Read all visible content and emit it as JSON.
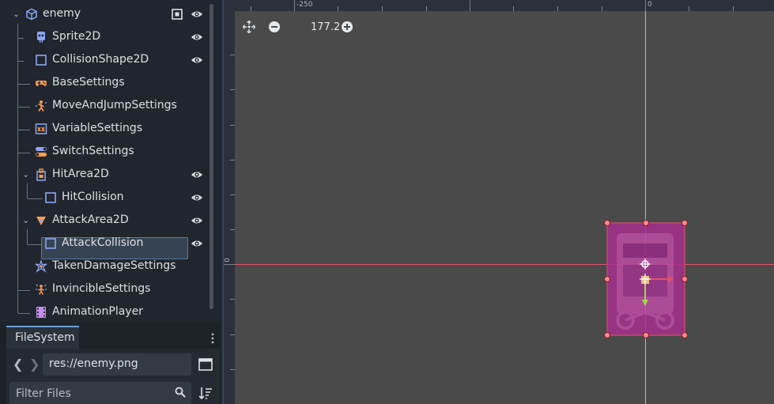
{
  "scene_tree": {
    "nodes": [
      {
        "label": "enemy",
        "icon": "node2d-icon"
      },
      {
        "label": "Sprite2D",
        "icon": "sprite2d-icon"
      },
      {
        "label": "CollisionShape2D",
        "icon": "collisionshape2d-icon"
      },
      {
        "label": "BaseSettings",
        "icon": "gamepad-icon"
      },
      {
        "label": "MoveAndJumpSettings",
        "icon": "move-jump-icon"
      },
      {
        "label": "VariableSettings",
        "icon": "variable-icon"
      },
      {
        "label": "SwitchSettings",
        "icon": "switch-icon"
      },
      {
        "label": "HitArea2D",
        "icon": "area2d-icon"
      },
      {
        "label": "HitCollision",
        "icon": "collisionshape2d-icon"
      },
      {
        "label": "AttackArea2D",
        "icon": "area2d-icon"
      },
      {
        "label": "AttackCollision",
        "icon": "collisionshape2d-icon"
      },
      {
        "label": "TakenDamageSettings",
        "icon": "damage-icon"
      },
      {
        "label": "InvincibleSettings",
        "icon": "invincible-icon"
      },
      {
        "label": "AnimationPlayer",
        "icon": "animationplayer-icon"
      }
    ],
    "selected": "AttackCollision"
  },
  "filesystem": {
    "tab_label": "FileSystem",
    "path": "res://enemy.png",
    "filter_placeholder": "Filter Files"
  },
  "viewport": {
    "zoom_label": "177.2 %",
    "ruler_labels": {
      "top_left": "-250",
      "top_right": "0",
      "left": "0"
    }
  },
  "colors": {
    "accent": "#6a9fd8",
    "node_blue": "#8da5f3",
    "orange": "#fc9c4f",
    "collision_fill": "#a52f8a",
    "handle": "#ff8a8a",
    "axis_x": "#e0536b",
    "axis_y": "#9dd94a"
  }
}
